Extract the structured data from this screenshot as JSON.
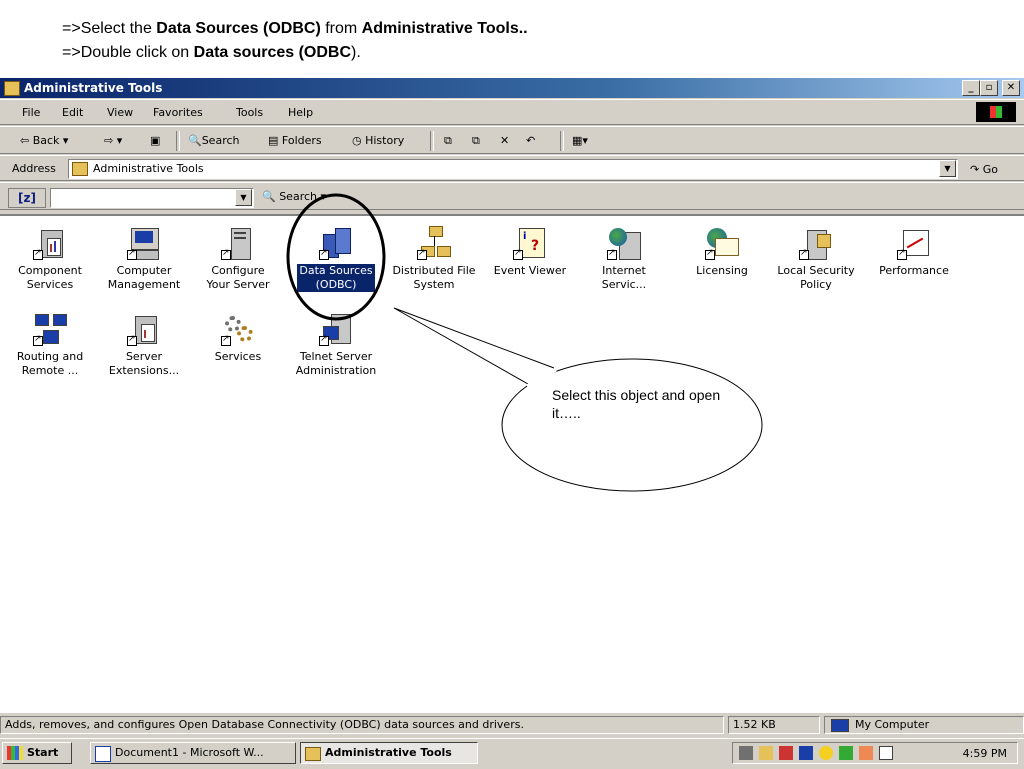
{
  "slide": {
    "line1": {
      "prefix": "=>Select the ",
      "bold1": "Data Sources (ODBC)",
      "mid": " from ",
      "bold2": "Administrative Tools.."
    },
    "line2": {
      "prefix": "=>Double click on  ",
      "bold1": "Data sources (ODBC",
      "suffix": ")."
    }
  },
  "window": {
    "title": "Administrative Tools",
    "buttons": {
      "minimize": "_",
      "maximize": "▫",
      "close": "✕"
    }
  },
  "menubar": [
    "File",
    "Edit",
    "View",
    "Favorites",
    "Tools",
    "Help"
  ],
  "toolbar": {
    "back": "Back",
    "search": "Search",
    "folders": "Folders",
    "history": "History"
  },
  "address": {
    "label": "Address",
    "value": "Administrative Tools",
    "go": "Go"
  },
  "linksbar": {
    "badge": "[z]",
    "search": "Search"
  },
  "icons": [
    {
      "l1": "Component",
      "l2": "Services",
      "icon": "component-services-icon"
    },
    {
      "l1": "Computer",
      "l2": "Management",
      "icon": "computer-management-icon"
    },
    {
      "l1": "Configure",
      "l2": "Your Server",
      "icon": "configure-server-icon"
    },
    {
      "l1": "Data Sources",
      "l2": "(ODBC)",
      "icon": "data-sources-odbc-icon"
    },
    {
      "l1": "Distributed File",
      "l2": "System",
      "icon": "distributed-file-system-icon"
    },
    {
      "l1": "Event Viewer",
      "l2": "",
      "icon": "event-viewer-icon"
    },
    {
      "l1": "Internet",
      "l2": "Servic...",
      "icon": "internet-services-icon"
    },
    {
      "l1": "Licensing",
      "l2": "",
      "icon": "licensing-icon"
    },
    {
      "l1": "Local Security",
      "l2": "Policy",
      "icon": "local-security-policy-icon"
    },
    {
      "l1": "Performance",
      "l2": "",
      "icon": "performance-icon"
    },
    {
      "l1": "Routing and",
      "l2": "Remote ...",
      "icon": "routing-remote-icon"
    },
    {
      "l1": "Server",
      "l2": "Extensions...",
      "icon": "server-extensions-icon"
    },
    {
      "l1": "Services",
      "l2": "",
      "icon": "services-icon"
    },
    {
      "l1": "Telnet Server",
      "l2": "Administration",
      "icon": "telnet-server-icon"
    }
  ],
  "callout": "Select this object and open it…..",
  "status": {
    "text": "Adds, removes, and configures Open Database Connectivity (ODBC) data sources and drivers.",
    "size": "1.52 KB",
    "zone": "My Computer"
  },
  "taskbar": {
    "start": "Start",
    "doc": "Document1 - Microsoft W...",
    "admin": "Administrative Tools",
    "clock": "4:59 PM"
  }
}
